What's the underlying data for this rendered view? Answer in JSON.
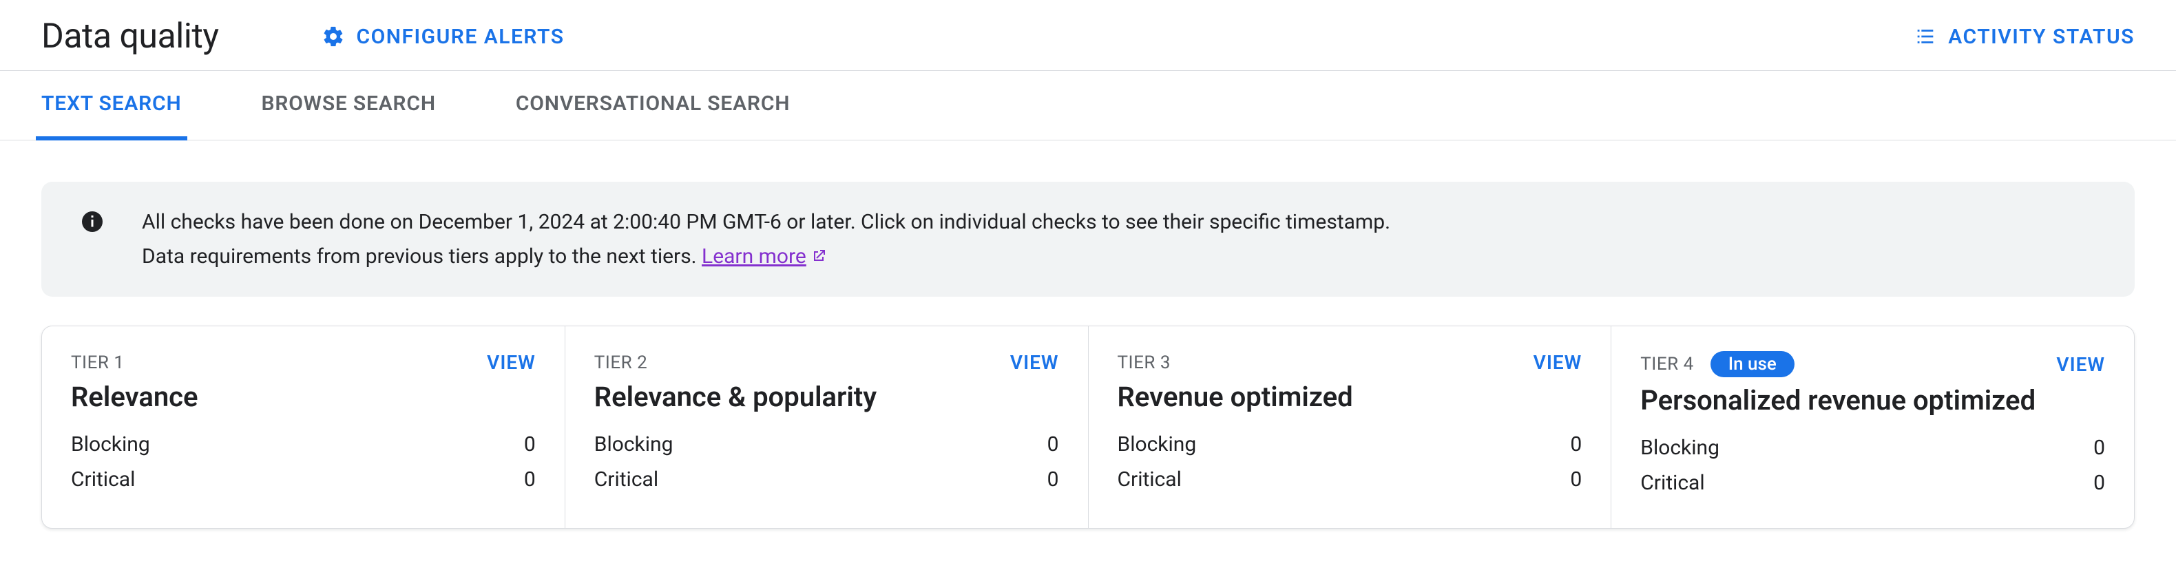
{
  "header": {
    "title": "Data quality",
    "configure_alerts": "CONFIGURE ALERTS",
    "activity_status": "ACTIVITY STATUS"
  },
  "tabs": {
    "items": [
      {
        "label": "TEXT SEARCH",
        "active": true
      },
      {
        "label": "BROWSE SEARCH",
        "active": false
      },
      {
        "label": "CONVERSATIONAL SEARCH",
        "active": false
      }
    ]
  },
  "banner": {
    "line1": "All checks have been done on December 1, 2024 at 2:00:40 PM GMT-6 or later. Click on individual checks to see their specific timestamp.",
    "line2_prefix": "Data requirements from previous tiers apply to the next tiers. ",
    "learn_more": "Learn more"
  },
  "tier_view_label": "VIEW",
  "tiers": [
    {
      "label": "TIER 1",
      "title": "Relevance",
      "badge": null,
      "rows": [
        {
          "name": "Blocking",
          "value": "0"
        },
        {
          "name": "Critical",
          "value": "0"
        }
      ]
    },
    {
      "label": "TIER 2",
      "title": "Relevance & popularity",
      "badge": null,
      "rows": [
        {
          "name": "Blocking",
          "value": "0"
        },
        {
          "name": "Critical",
          "value": "0"
        }
      ]
    },
    {
      "label": "TIER 3",
      "title": "Revenue optimized",
      "badge": null,
      "rows": [
        {
          "name": "Blocking",
          "value": "0"
        },
        {
          "name": "Critical",
          "value": "0"
        }
      ]
    },
    {
      "label": "TIER 4",
      "title": "Personalized revenue optimized",
      "badge": "In use",
      "rows": [
        {
          "name": "Blocking",
          "value": "0"
        },
        {
          "name": "Critical",
          "value": "0"
        }
      ]
    }
  ]
}
